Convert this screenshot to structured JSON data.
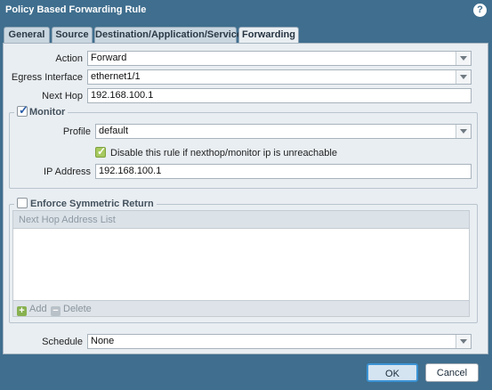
{
  "window": {
    "title": "Policy Based Forwarding Rule",
    "help_icon": "?"
  },
  "tabs": [
    {
      "label": "General",
      "active": false
    },
    {
      "label": "Source",
      "active": false
    },
    {
      "label": "Destination/Application/Service",
      "active": false
    },
    {
      "label": "Forwarding",
      "active": true
    }
  ],
  "form": {
    "action_label": "Action",
    "action_value": "Forward",
    "egress_label": "Egress Interface",
    "egress_value": "ethernet1/1",
    "nexthop_label": "Next Hop",
    "nexthop_value": "192.168.100.1"
  },
  "monitor": {
    "legend": "Monitor",
    "checked": true,
    "profile_label": "Profile",
    "profile_value": "default",
    "disable_rule_label": "Disable this rule if nexthop/monitor ip is unreachable",
    "disable_rule_checked": true,
    "ip_label": "IP Address",
    "ip_value": "192.168.100.1"
  },
  "symmetric": {
    "legend": "Enforce Symmetric Return",
    "checked": false,
    "list_header": "Next Hop Address List",
    "add_label": "Add",
    "delete_label": "Delete"
  },
  "schedule": {
    "label": "Schedule",
    "value": "None"
  },
  "buttons": {
    "ok": "OK",
    "cancel": "Cancel"
  },
  "colors": {
    "titlebar": "#3f6e8e",
    "panel": "#e9eef2",
    "accent": "#3b93d4",
    "checkbox_green": "#a7c95f"
  }
}
